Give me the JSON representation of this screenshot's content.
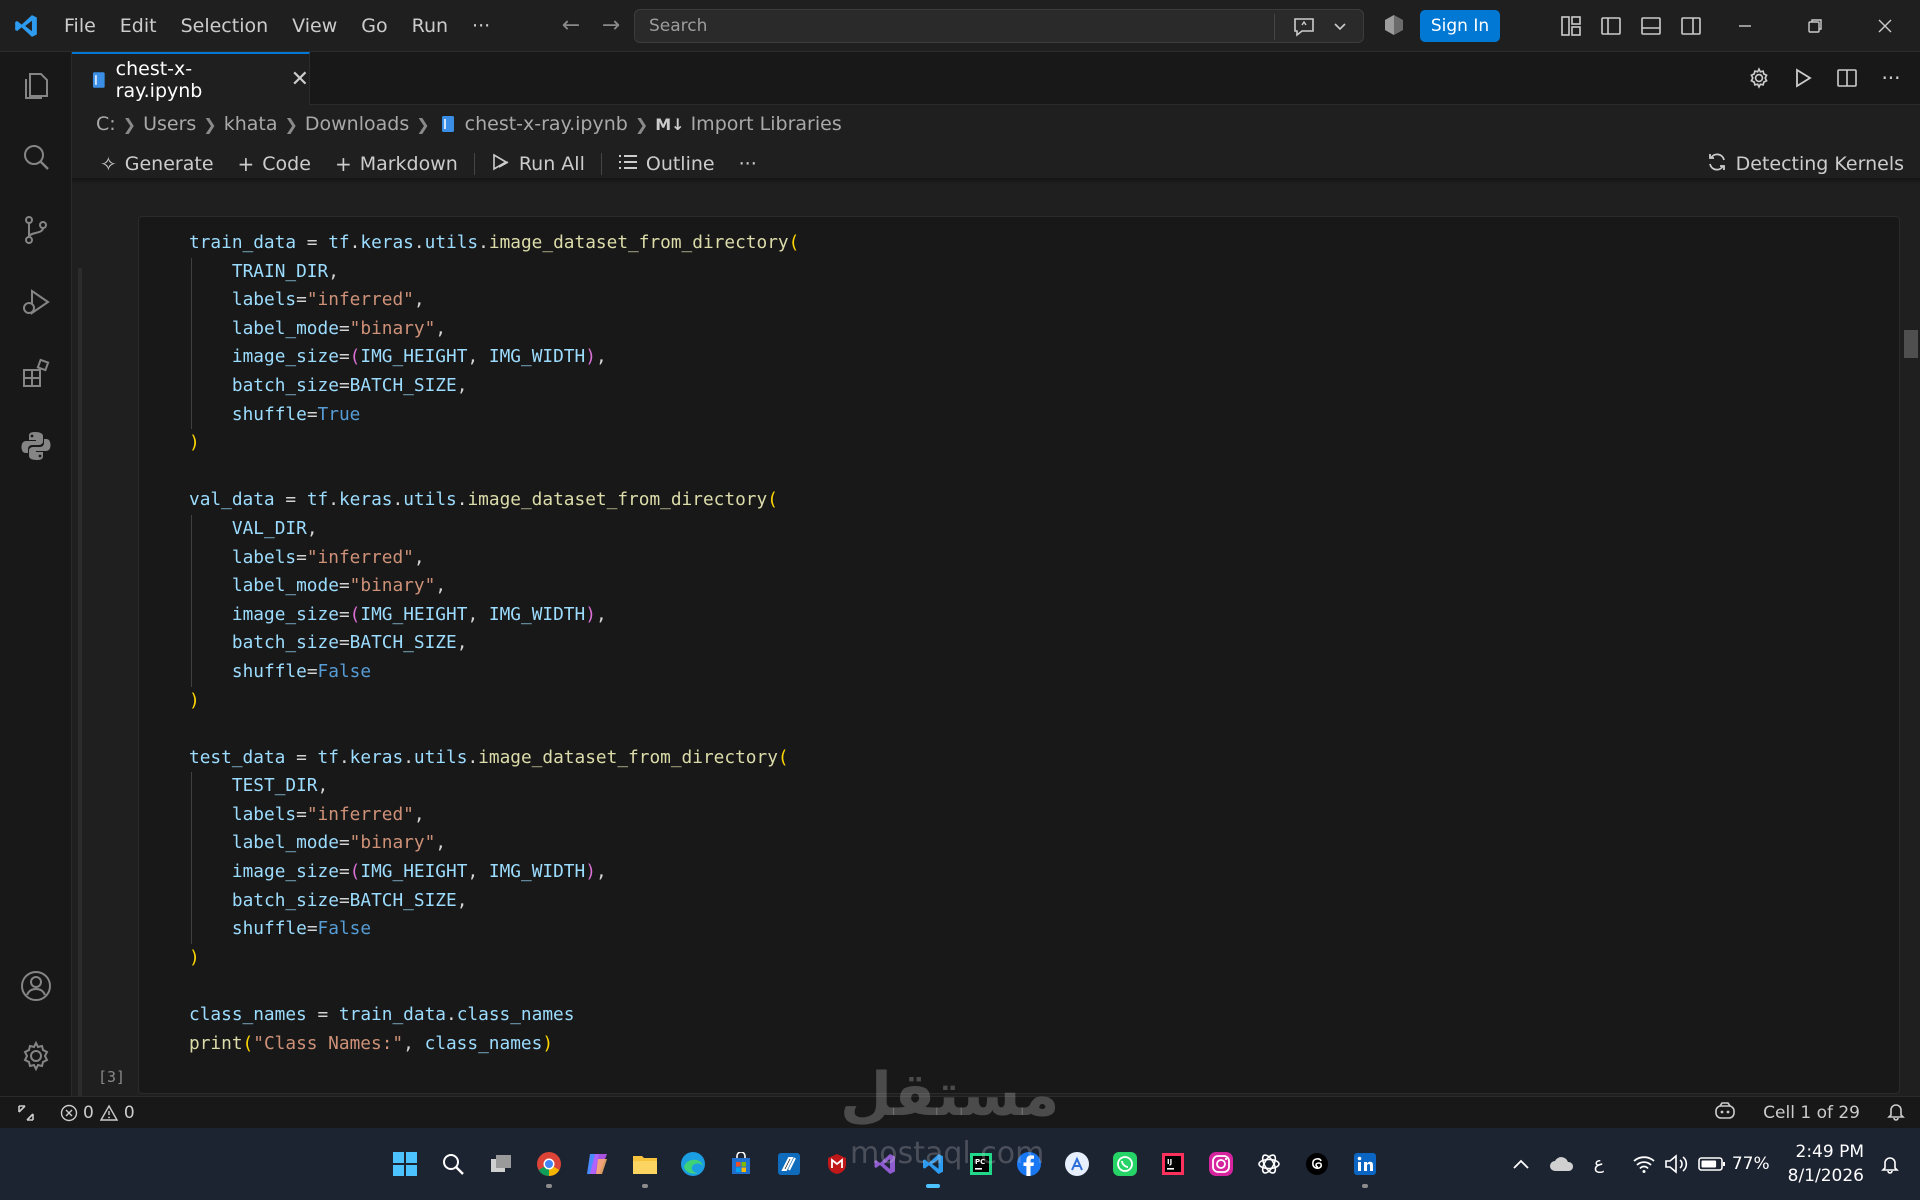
{
  "menu": [
    "File",
    "Edit",
    "Selection",
    "View",
    "Go",
    "Run",
    "···"
  ],
  "search": {
    "placeholder": "Search"
  },
  "signin_label": "Sign In",
  "tab": {
    "label": "chest-x-ray.ipynb"
  },
  "breadcrumb": [
    "C:",
    "Users",
    "khata",
    "Downloads",
    "chest-x-ray.ipynb",
    "Import Libraries"
  ],
  "toolbar": {
    "generate": "Generate",
    "code": "Code",
    "markdown": "Markdown",
    "run_all": "Run All",
    "outline": "Outline",
    "more": "···",
    "kernel": "Detecting Kernels"
  },
  "cell": {
    "exec_count": "[3]",
    "lines": [
      "train_data = tf.keras.utils.image_dataset_from_directory(",
      "    TRAIN_DIR,",
      "    labels=\"inferred\",",
      "    label_mode=\"binary\",",
      "    image_size=(IMG_HEIGHT, IMG_WIDTH),",
      "    batch_size=BATCH_SIZE,",
      "    shuffle=True",
      ")",
      "",
      "val_data = tf.keras.utils.image_dataset_from_directory(",
      "    VAL_DIR,",
      "    labels=\"inferred\",",
      "    label_mode=\"binary\",",
      "    image_size=(IMG_HEIGHT, IMG_WIDTH),",
      "    batch_size=BATCH_SIZE,",
      "    shuffle=False",
      ")",
      "",
      "test_data = tf.keras.utils.image_dataset_from_directory(",
      "    TEST_DIR,",
      "    labels=\"inferred\",",
      "    label_mode=\"binary\",",
      "    image_size=(IMG_HEIGHT, IMG_WIDTH),",
      "    batch_size=BATCH_SIZE,",
      "    shuffle=False",
      ")",
      "",
      "class_names = train_data.class_names",
      "print(\"Class Names:\", class_names)"
    ]
  },
  "status": {
    "errors": "0",
    "warnings": "0",
    "cell_position": "Cell 1 of 29"
  },
  "taskbar": {
    "lang": "ع",
    "battery": "77%",
    "time": "2:49 PM",
    "date": "8/1/2026"
  },
  "watermark": {
    "arabic": "مستقل",
    "latin": "mostaql.com"
  },
  "colors": {
    "accent": "#0078d4",
    "editor_bg": "#1f1f1f",
    "cell_bg": "#181818",
    "taskbar_bg": "#1c2331"
  }
}
